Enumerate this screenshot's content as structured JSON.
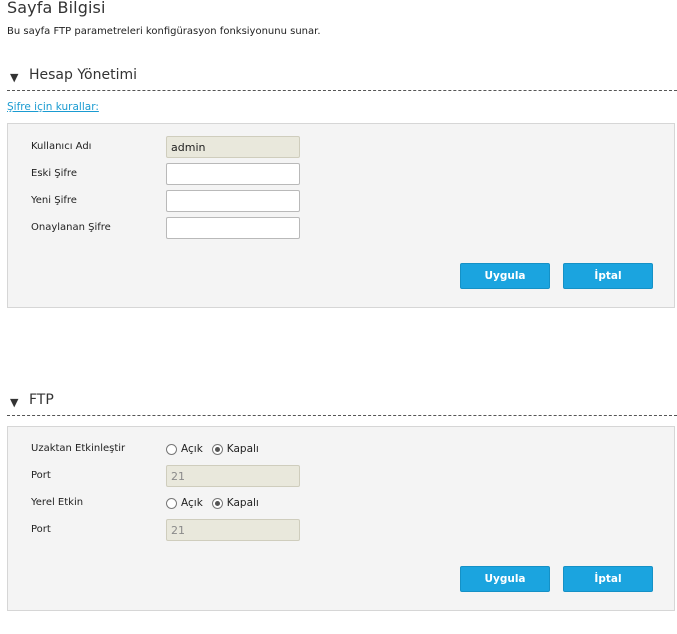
{
  "page": {
    "title": "Sayfa Bilgisi",
    "description": "Bu sayfa FTP parametreleri konfigürasyon fonksiyonunu sunar."
  },
  "account": {
    "section_title": "Hesap Yönetimi",
    "password_rules_link": "Şifre için kurallar:",
    "username_label": "Kullanıcı Adı",
    "username_value": "admin",
    "old_password_label": "Eski Şifre",
    "new_password_label": "Yeni Şifre",
    "confirm_password_label": "Onaylanan Şifre",
    "apply_label": "Uygula",
    "cancel_label": "İptal"
  },
  "ftp": {
    "section_title": "FTP",
    "remote_enable_label": "Uzaktan Etkinleştir",
    "remote_on_label": "Açık",
    "remote_off_label": "Kapalı",
    "remote_selected": "Kapalı",
    "remote_port_label": "Port",
    "remote_port_value": "21",
    "local_enable_label": "Yerel Etkin",
    "local_on_label": "Açık",
    "local_off_label": "Kapalı",
    "local_selected": "Kapalı",
    "local_port_label": "Port",
    "local_port_value": "21",
    "apply_label": "Uygula",
    "cancel_label": "İptal"
  },
  "icons": {
    "section_toggle": "triangle-down-icon"
  },
  "colors": {
    "accent_button": "#1ba4df",
    "link": "#1a9bd1",
    "panel_bg": "#f4f4f4",
    "readonly_field": "#e9e8dc"
  }
}
